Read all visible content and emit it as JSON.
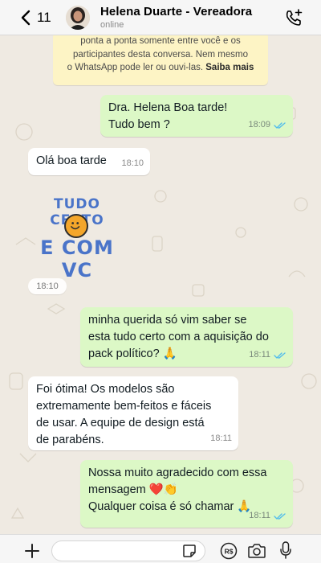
{
  "header": {
    "back_count": "11",
    "contact_name": "Helena Duarte - Vereadora",
    "status": "online"
  },
  "notice": {
    "line1": "ponta a ponta somente entre você e os",
    "line2": "participantes desta conversa. Nem mesmo",
    "line3": "o WhatsApp pode ler ou ouvi-las.",
    "link": "Saiba mais"
  },
  "messages": [
    {
      "direction": "out",
      "lines": [
        "Dra. Helena Boa tarde!",
        "Tudo bem ?"
      ],
      "time": "18:09",
      "read": true
    },
    {
      "direction": "in",
      "lines": [
        "Olá boa tarde"
      ],
      "time": "18:10"
    },
    {
      "direction": "out",
      "lines": [
        "minha querida só vim saber se",
        "esta tudo certo com a aquisição do",
        "pack político? 🙏"
      ],
      "time": "18:11",
      "read": true
    },
    {
      "direction": "in",
      "lines": [
        "Foi ótima! Os modelos são",
        "extremamente bem-feitos e fáceis",
        "de usar. A equipe de design está",
        "de parabéns."
      ],
      "time": "18:11"
    },
    {
      "direction": "out",
      "lines": [
        "Nossa muito agradecido com essa",
        "mensagem ❤️👏",
        "Qualquer coisa é só chamar 🙏"
      ],
      "time": "18:11",
      "read": true
    }
  ],
  "sticker": {
    "line1": "TUDO CERTO",
    "line2": "E COM VC",
    "time": "18:10"
  },
  "input": {
    "placeholder": ""
  },
  "colors": {
    "outgoing_bubble": "#dcf8c6",
    "incoming_bubble": "#ffffff",
    "chat_background": "#efeae2",
    "notice_background": "#fdf4c5",
    "read_ticks": "#53bdeb",
    "sticker_text": "#4a74c9"
  }
}
